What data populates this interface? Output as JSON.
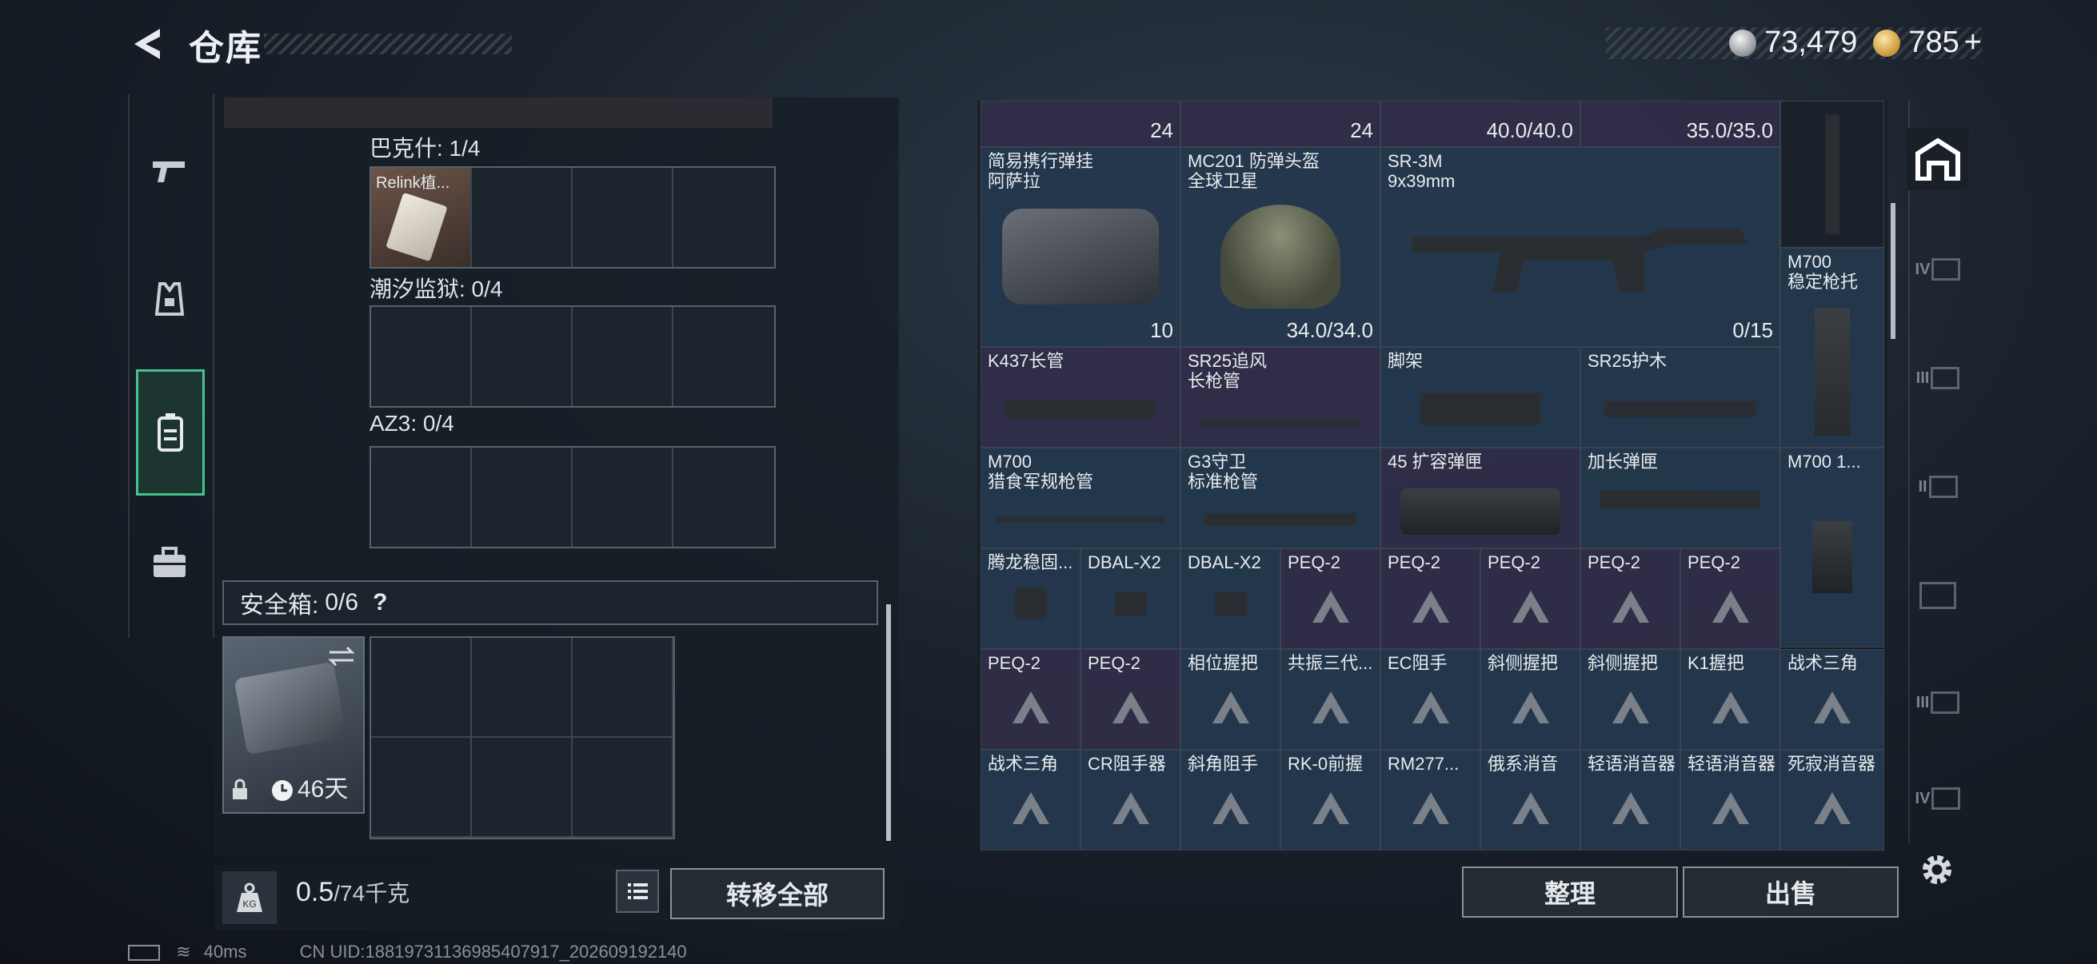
{
  "header": {
    "title": "仓库"
  },
  "currency": {
    "silver": "73,479",
    "gold": "785",
    "gold_plus": "+"
  },
  "left": {
    "rows": [
      {
        "label": "巴克什: 1/4",
        "first_item": "Relink植..."
      },
      {
        "label": "潮汐监狱: 0/4"
      },
      {
        "label": "AZ3: 0/4"
      }
    ],
    "safe_label": "安全箱:",
    "safe_count": "0/6",
    "safe_help": "?",
    "safe_days": "46天",
    "weight_value": "0.5",
    "weight_unit": "/74千克",
    "kg_icon_text": "KG",
    "transfer_all": "转移全部"
  },
  "grid": {
    "top_row": [
      {
        "text": "24",
        "x": "c1"
      },
      {
        "text": "24",
        "x": "c2"
      },
      {
        "text": "40.0/40.0",
        "x": "c3"
      },
      {
        "text": "35.0/35.0",
        "x": "c4"
      }
    ],
    "items": [
      {
        "l1": "简易携行弹挂",
        "l2": "阿萨拉",
        "br": "10"
      },
      {
        "l1": "MC201 防弹头盔",
        "l2": "全球卫星",
        "br": "34.0/34.0"
      },
      {
        "l1": "SR-3M",
        "l2": "9x39mm",
        "br": "0/15"
      },
      {
        "l1": "M700",
        "l2": "稳定枪托"
      },
      {
        "l1": "K437长管"
      },
      {
        "l1": "SR25追风",
        "l2": "长枪管"
      },
      {
        "l1": "脚架"
      },
      {
        "l1": "SR25护木"
      },
      {
        "l1": "M700",
        "l2": "猎食军规枪管"
      },
      {
        "l1": "G3守卫",
        "l2": "标准枪管"
      },
      {
        "l1": "45 扩容弹匣"
      },
      {
        "l1": "加长弹匣"
      },
      {
        "l1": "M700 1..."
      },
      {
        "l1": "腾龙稳固..."
      },
      {
        "l1": "DBAL-X2"
      },
      {
        "l1": "DBAL-X2"
      },
      {
        "l1": "PEQ-2"
      },
      {
        "l1": "PEQ-2"
      },
      {
        "l1": "PEQ-2"
      },
      {
        "l1": "PEQ-2"
      },
      {
        "l1": "PEQ-2"
      },
      {
        "l1": "PEQ-2"
      },
      {
        "l1": "PEQ-2"
      },
      {
        "l1": "相位握把"
      },
      {
        "l1": "共振三代..."
      },
      {
        "l1": "EC阻手"
      },
      {
        "l1": "斜侧握把"
      },
      {
        "l1": "斜侧握把"
      },
      {
        "l1": "K1握把"
      },
      {
        "l1": "战术三角"
      },
      {
        "l1": "战术三角"
      },
      {
        "l1": "CR阻手器"
      },
      {
        "l1": "斜角阻手"
      },
      {
        "l1": "RK-0前握"
      },
      {
        "l1": "RM277..."
      },
      {
        "l1": "俄系消音"
      },
      {
        "l1": "轻语消音器"
      },
      {
        "l1": "轻语消音器"
      },
      {
        "l1": "死寂消音器"
      }
    ]
  },
  "buttons": {
    "sort": "整理",
    "sell": "出售"
  },
  "right_rail": [
    "IV",
    "III",
    "II",
    "III",
    "IV"
  ],
  "status": {
    "ping": "40ms",
    "uid": "CN UID:18819731136985407917_202609192140"
  }
}
